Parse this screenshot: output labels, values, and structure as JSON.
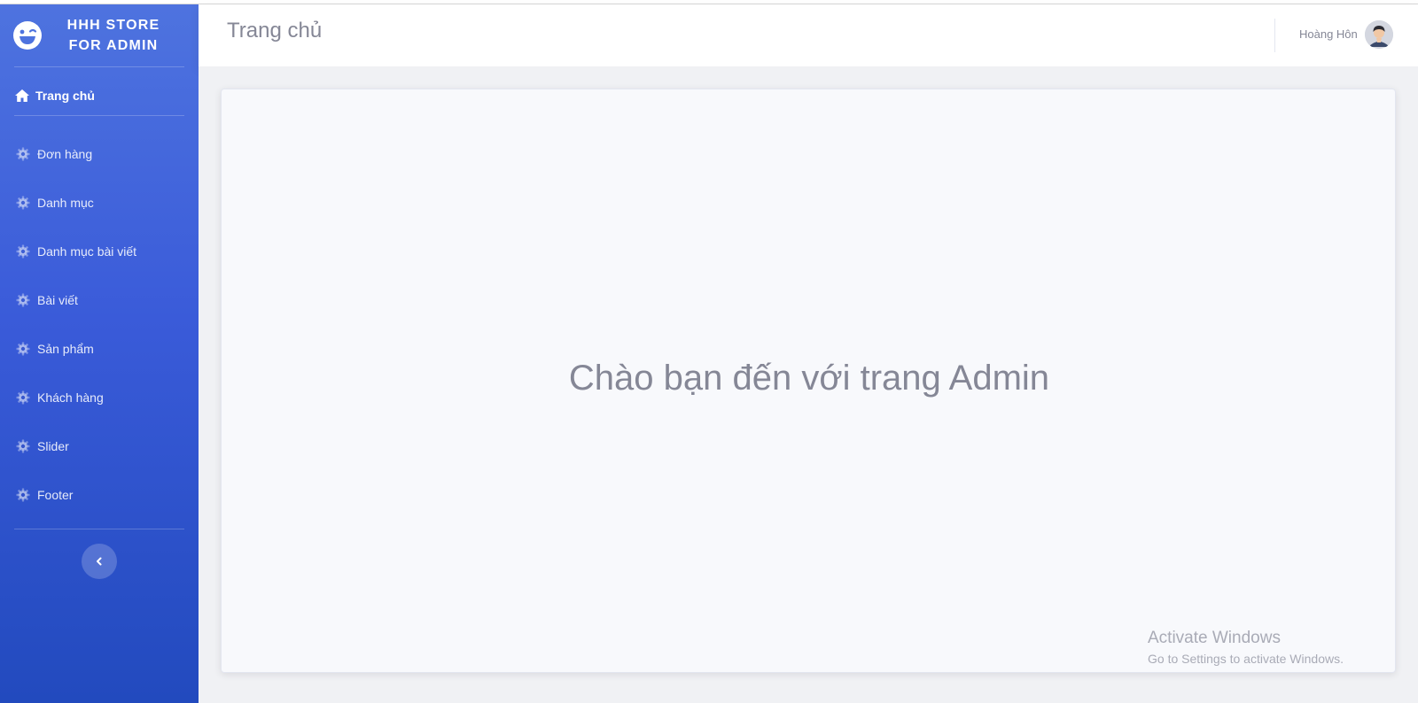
{
  "brand": {
    "line1": "HHH STORE",
    "line2": "FOR ADMIN",
    "icon": "laugh-wink-icon"
  },
  "sidebar": {
    "home": {
      "label": "Trang chủ",
      "icon": "home-icon"
    },
    "items": [
      {
        "label": "Đơn hàng",
        "icon": "cog-icon"
      },
      {
        "label": "Danh mục",
        "icon": "cog-icon"
      },
      {
        "label": "Danh mục bài viết",
        "icon": "cog-icon"
      },
      {
        "label": "Bài viết",
        "icon": "cog-icon"
      },
      {
        "label": "Sản phẩm",
        "icon": "cog-icon"
      },
      {
        "label": "Khách hàng",
        "icon": "cog-icon"
      },
      {
        "label": "Slider",
        "icon": "cog-icon"
      },
      {
        "label": "Footer",
        "icon": "cog-icon"
      }
    ],
    "toggle_icon": "chevron-left-icon"
  },
  "topbar": {
    "title": "Trang chủ",
    "user_name": "Hoàng Hôn"
  },
  "main": {
    "welcome": "Chào bạn đến với trang Admin"
  },
  "watermark": {
    "line1": "Activate Windows",
    "line2": "Go to Settings to activate Windows."
  },
  "colors": {
    "sidebar_top": "#4e73df",
    "sidebar_bottom": "#224abe",
    "text_muted": "#858796",
    "card_bg": "#f8f9fc"
  }
}
